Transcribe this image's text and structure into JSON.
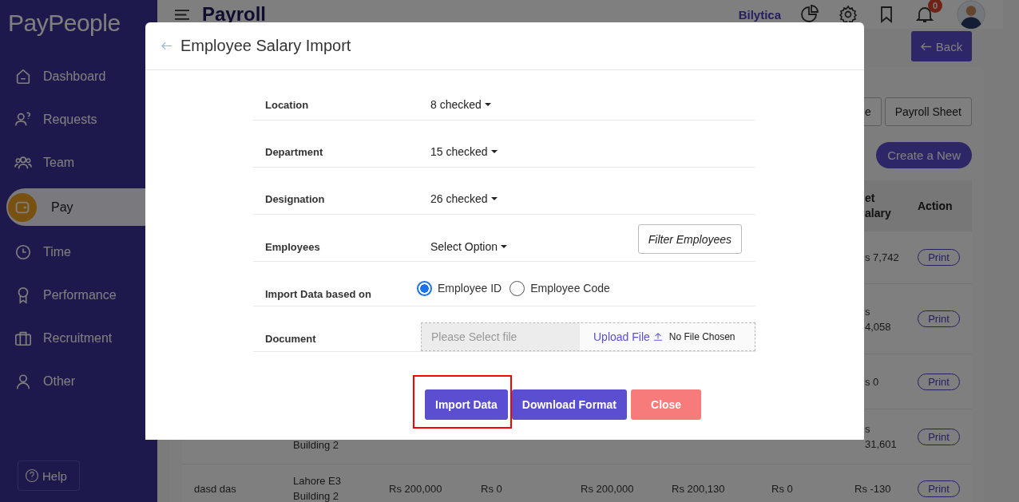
{
  "sidebar": {
    "logo": "PayPeople",
    "items": [
      {
        "label": "Dashboard",
        "selected": false
      },
      {
        "label": "Requests",
        "selected": false
      },
      {
        "label": "Team",
        "selected": false
      },
      {
        "label": "Pay",
        "selected": true
      },
      {
        "label": "Time",
        "selected": false
      },
      {
        "label": "Performance",
        "selected": false
      },
      {
        "label": "Recruitment",
        "selected": false
      },
      {
        "label": "Other",
        "selected": false
      }
    ],
    "help": "Help"
  },
  "header": {
    "title": "Payroll",
    "company": "Bilytica",
    "notifications": "0"
  },
  "back_button": "Back",
  "toolbar": {
    "buttons": [
      "e",
      "Payroll Sheet"
    ],
    "create_button": "Create a New"
  },
  "table": {
    "columns": {
      "net_salary": [
        "et",
        "alary"
      ],
      "action": [
        "Action"
      ]
    },
    "rows": [
      {
        "kind": "behind_modal",
        "net_salary": [
          "s 7,742"
        ],
        "action": "Print"
      },
      {
        "kind": "behind_modal",
        "net_salary": [
          "s",
          "4,058"
        ],
        "action": "Print"
      },
      {
        "kind": "behind_modal",
        "net_salary": [
          "s 0"
        ],
        "action": "Print"
      },
      {
        "kind": "behind_modal",
        "location": [
          "Building 2"
        ],
        "net_salary": [
          "s",
          "31,601"
        ],
        "action": "Print"
      },
      {
        "kind": "full",
        "name": [
          "dasd das"
        ],
        "location": [
          "Lahore E3",
          "Building 2"
        ],
        "column_3": [
          "Rs 200,000"
        ],
        "column_4": [
          "Rs 0"
        ],
        "column_5": [
          "Rs 200,000"
        ],
        "column_6": [
          "Rs 200,130"
        ],
        "column_7": [
          "Rs 0"
        ],
        "net_salary": [
          "Rs -130"
        ],
        "action": "Print"
      }
    ]
  },
  "modal": {
    "title": "Employee Salary Import",
    "fields": [
      {
        "kind": "dropdown",
        "label": "Location",
        "value": "8 checked"
      },
      {
        "kind": "dropdown",
        "label": "Department",
        "value": "15 checked"
      },
      {
        "kind": "dropdown",
        "label": "Designation",
        "value": "26 checked"
      },
      {
        "kind": "dropdown",
        "label": "Employees",
        "value": "Select Option",
        "button": "Filter Employees"
      },
      {
        "kind": "radio",
        "label": "Import Data based on",
        "options": [
          {
            "label": "Employee ID",
            "selected": true
          },
          {
            "label": "Employee Code",
            "selected": false
          }
        ]
      },
      {
        "kind": "file",
        "label": "Document",
        "placeholder": "Please Select file",
        "upload": "Upload File",
        "status": "No File Chosen"
      }
    ],
    "buttons": [
      {
        "label": "Import Data",
        "kind": "primary",
        "highlighted": true
      },
      {
        "label": "Download Format",
        "kind": "primary",
        "highlighted": false
      },
      {
        "label": "Close",
        "kind": "danger",
        "highlighted": false
      }
    ]
  }
}
